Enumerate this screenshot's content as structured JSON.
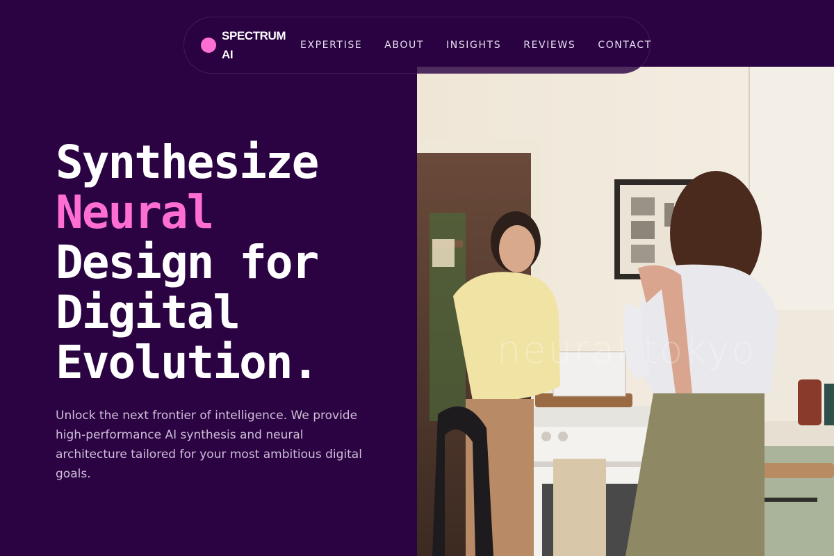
{
  "brand": {
    "name_line1": "SPECTRUM",
    "name_line2": "AI",
    "accent_color": "#ff6ed2",
    "background_color": "#2b0342"
  },
  "nav": {
    "items": [
      {
        "label": "EXPERTISE"
      },
      {
        "label": "ABOUT"
      },
      {
        "label": "INSIGHTS"
      },
      {
        "label": "REVIEWS"
      },
      {
        "label": "CONTACT"
      }
    ]
  },
  "hero": {
    "headline_lines": [
      "Synthesize",
      "Neural",
      "Design for",
      "Digital",
      "Evolution."
    ],
    "accent_line_index": 1,
    "subtext": "Unlock the next frontier of intelligence. We provide high-performance AI synthesis and neural architecture tailored for your most ambitious digital goals.",
    "image": {
      "subject": "two-women-in-kitchen-with-laptop",
      "watermark": "neural tokyo"
    }
  }
}
